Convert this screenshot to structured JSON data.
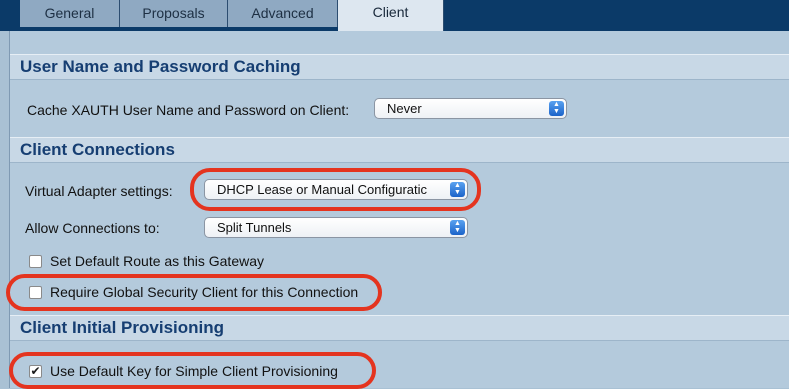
{
  "tabs": [
    {
      "label": "General"
    },
    {
      "label": "Proposals"
    },
    {
      "label": "Advanced"
    },
    {
      "label": "Client"
    }
  ],
  "active_tab": "Client",
  "sections": {
    "caching": {
      "title": "User Name and Password Caching",
      "cache_label": "Cache XAUTH User Name and Password on Client:",
      "cache_value": "Never"
    },
    "connections": {
      "title": "Client Connections",
      "virtual_adapter_label": "Virtual Adapter settings:",
      "virtual_adapter_value": "DHCP Lease or Manual Configuratic",
      "allow_label": "Allow Connections to:",
      "allow_value": "Split Tunnels",
      "default_route_label": "Set Default Route as this Gateway",
      "default_route_checked": false,
      "require_gsc_label": "Require Global Security Client for this Connection",
      "require_gsc_checked": false
    },
    "provisioning": {
      "title": "Client Initial Provisioning",
      "default_key_label": "Use Default Key for Simple Client Provisioning",
      "default_key_checked": true
    }
  },
  "icons": {
    "select_arrows": "updown-chevron-icon",
    "check": "checkmark-icon"
  },
  "colors": {
    "tab_bar": "#0b3a68",
    "section_title": "#163e72",
    "highlight": "#e4341f",
    "select_arrow": "#1b63c9"
  }
}
